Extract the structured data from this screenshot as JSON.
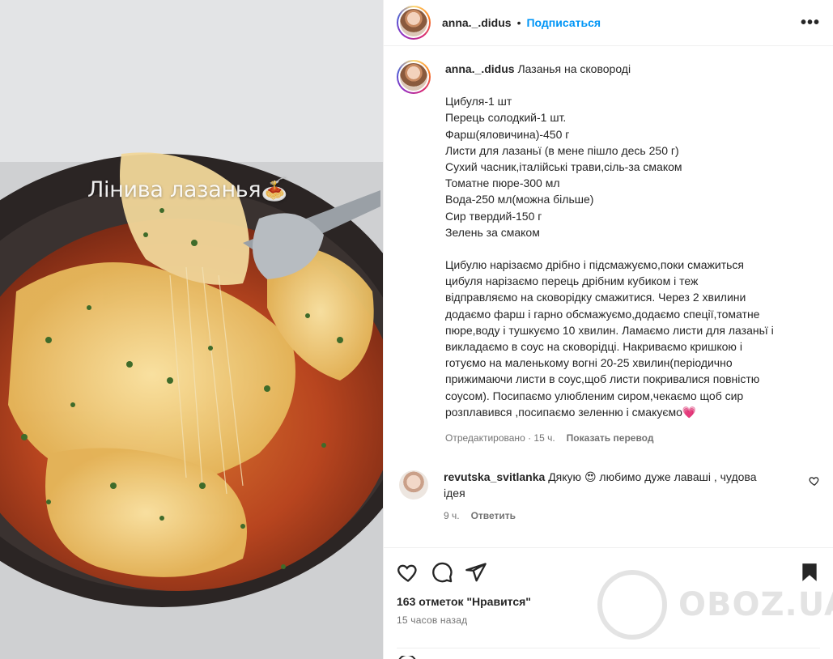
{
  "media": {
    "overlay_text": "Лінива лазанья🍝"
  },
  "header": {
    "username": "anna._.didus",
    "separator": "•",
    "follow_label": "Подписаться",
    "more_label": "•••"
  },
  "caption": {
    "username": "anna._.didus",
    "title": "Лазанья на сковороді",
    "ingredients": [
      "Цибуля-1 шт",
      "Перець солодкий-1 шт.",
      "Фарш(яловичина)-450 г",
      "Листи для лазаньї (в мене пішло десь 250 г)",
      "Сухий часник,італійські трави,сіль-за смаком",
      "Томатне пюре-300 мл",
      "Вода-250 мл(можна більше)",
      "Сир твердий-150 г",
      "Зелень за смаком"
    ],
    "method_lines": [
      "Цибулю нарізаємо дрібно і підсмажуємо,поки смажиться",
      "цибуля нарізаємо перець дрібним кубиком і теж",
      "відправляємо на сковорідку смажитися. Через 2 хвилини",
      "додаємо фарш і гарно обсмажуємо,додаємо спеції,томатне",
      "пюре,воду і тушкуємо 10 хвилин. Ламаємо листи для лазаньї і",
      "викладаємо в соус на сковорідці. Накриваємо кришкою і",
      "готуємо на маленькому вогні 20-25 хвилин(періодично",
      "прижимаючи листи в соус,щоб листи покривалися повністю",
      "соусом). Посипаємо улюбленим сиром,чекаємо щоб сир",
      "розплавився ,посипаємо зеленню і смакуємо💗"
    ],
    "edited": "Отредактировано · 15 ч.",
    "translate_label": "Показать перевод"
  },
  "comment": {
    "username": "revutska_svitlanka",
    "text_line1": "Дякую 😍 любимо дуже лаваші , чудова",
    "text_line2": "ідея",
    "time": "9 ч.",
    "reply_label": "Ответить"
  },
  "footer": {
    "likes": "163 отметок \"Нравится\"",
    "time": "15 часов назад"
  },
  "watermark": {
    "text": "OBOZ.UA"
  },
  "colors": {
    "accent": "#0095f6",
    "text": "#262626",
    "muted": "#737373",
    "divider": "#efefef"
  }
}
